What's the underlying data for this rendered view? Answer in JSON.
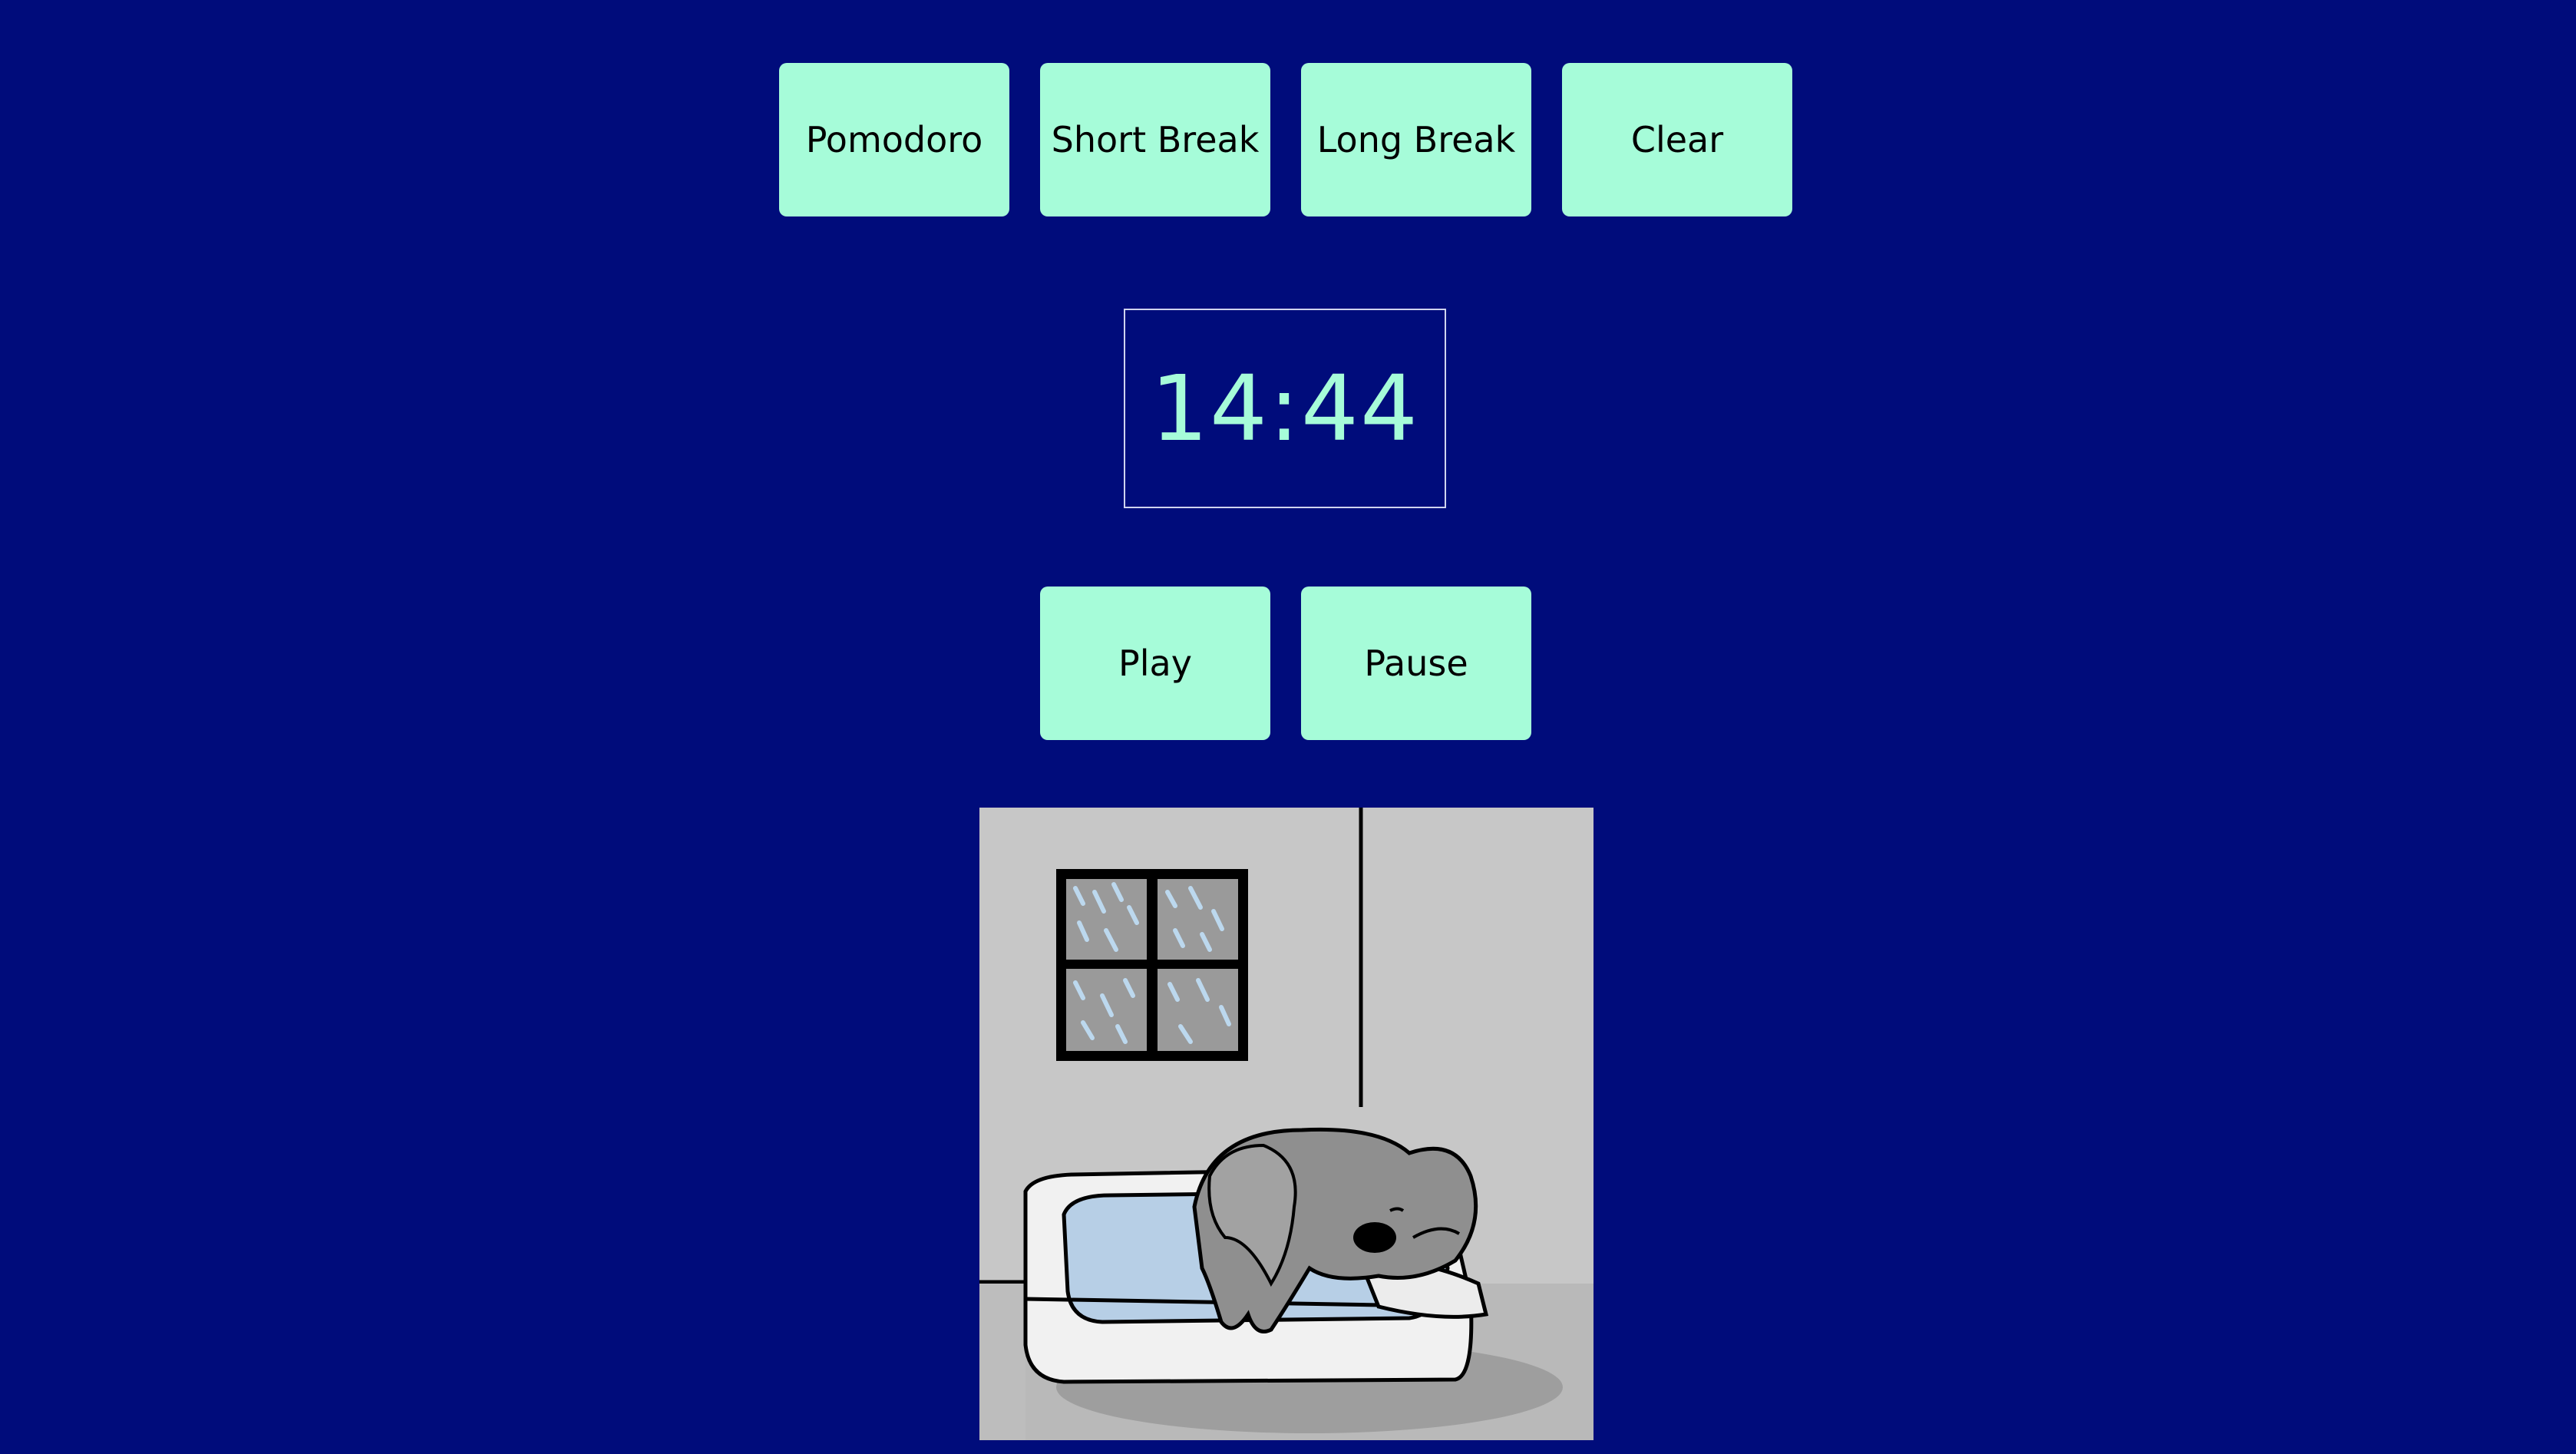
{
  "modes": {
    "pomodoro_label": "Pomodoro",
    "short_break_label": "Short Break",
    "long_break_label": "Long Break",
    "clear_label": "Clear"
  },
  "timer": {
    "display": "14:44"
  },
  "controls": {
    "play_label": "Play",
    "pause_label": "Pause"
  },
  "illustration": {
    "subject": "sleeping-koala-on-bed"
  },
  "colors": {
    "background": "#000c7b",
    "button": "#a6fcd9",
    "timer_text": "#a6fcd9"
  }
}
